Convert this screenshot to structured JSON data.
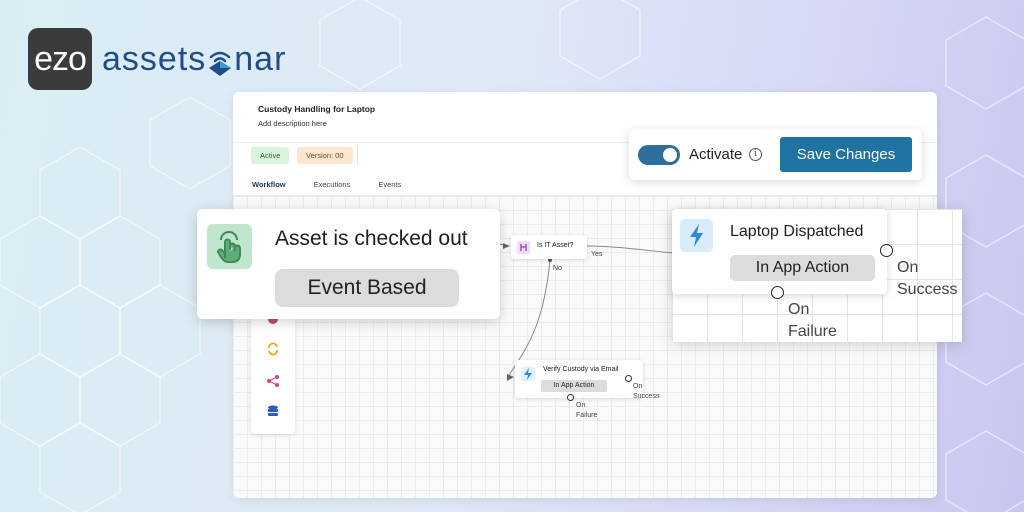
{
  "logo": {
    "ezo": "ezo",
    "brand_left": "assets",
    "brand_right": "nar"
  },
  "workflow": {
    "title": "Custody Handling for Laptop",
    "description": "Add description here",
    "status_badge": "Active",
    "version_badge": "Version: 00",
    "tabs": [
      {
        "label": "Workflow",
        "active": true
      },
      {
        "label": "Executions",
        "active": false
      },
      {
        "label": "Events",
        "active": false
      }
    ]
  },
  "header_actions": {
    "activate_label": "Activate",
    "activate_on": true,
    "info_glyph": "i",
    "save_label": "Save Changes"
  },
  "nodes": {
    "event": {
      "title": "Asset is checked out",
      "type": "Event Based"
    },
    "condition": {
      "title": "Is IT Asset?",
      "yes_label": "Yes",
      "no_label": "No"
    },
    "verify": {
      "title": "Verify Custody via Email",
      "type": "In App Action",
      "on_success": [
        "On",
        "Success"
      ],
      "on_failure": [
        "On",
        "Failure"
      ]
    },
    "laptop": {
      "title": "Laptop Dispatched",
      "type": "In App Action",
      "on_success": [
        "On",
        "Success"
      ],
      "on_failure": [
        "On",
        "Failure"
      ]
    }
  },
  "toolbox": {
    "icons": [
      "event-icon",
      "refresh-icon",
      "share-icon",
      "database-icon"
    ]
  },
  "colors": {
    "primary": "#1f73a0",
    "toggle": "#2d6f99",
    "active_badge": "#d9f3dd",
    "version_badge": "#fde6cf",
    "event_icon_bg": "#bfe6cc",
    "action_icon_bg": "#d9ecfa",
    "brand": "#1f4d8a"
  }
}
